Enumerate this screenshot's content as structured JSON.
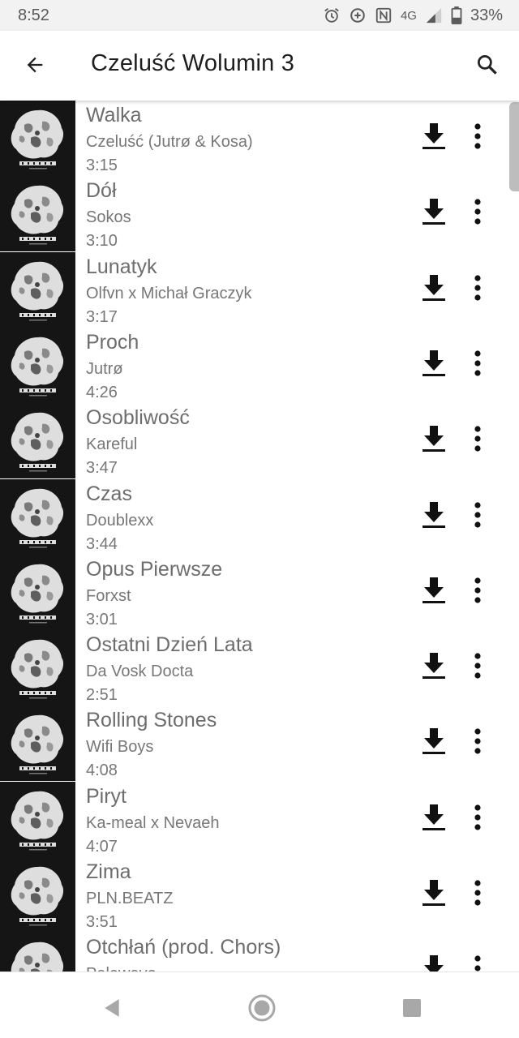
{
  "status_bar": {
    "time": "8:52",
    "network": "4G",
    "battery": "33%",
    "icons": [
      "alarm-icon",
      "data-saver-icon",
      "nfc-icon",
      "signal-icon",
      "battery-icon"
    ]
  },
  "app_bar": {
    "title": "Czeluść Wolumin 3",
    "back_icon": "arrow-back-icon",
    "search_icon": "search-icon"
  },
  "cover_art": {
    "label": "CZELUŚĆ"
  },
  "tracks": [
    {
      "title": "Walka",
      "artist": "Czeluść (Jutrø & Kosa)",
      "duration": "3:15"
    },
    {
      "title": "Dół",
      "artist": "Sokos",
      "duration": "3:10"
    },
    {
      "title": "Lunatyk",
      "artist": "Olfvn x Michał Graczyk",
      "duration": "3:17"
    },
    {
      "title": "Proch",
      "artist": "Jutrø",
      "duration": "4:26"
    },
    {
      "title": "Osobliwość",
      "artist": "Kareful",
      "duration": "3:47"
    },
    {
      "title": "Czas",
      "artist": "Doublexx",
      "duration": "3:44"
    },
    {
      "title": "Opus Pierwsze",
      "artist": "Forxst",
      "duration": "3:01"
    },
    {
      "title": "Ostatni Dzień Lata",
      "artist": "Da Vosk Docta",
      "duration": "2:51"
    },
    {
      "title": "Rolling Stones",
      "artist": "Wifi Boys",
      "duration": "4:08"
    },
    {
      "title": "Piryt",
      "artist": "Ka-meal x Nevaeh",
      "duration": "4:07"
    },
    {
      "title": "Zima",
      "artist": "PLN.BEATZ",
      "duration": "3:51"
    },
    {
      "title": "Otchłań (prod. Chors)",
      "artist": "Palewave",
      "duration": ""
    }
  ],
  "row_icons": {
    "download": "download-icon",
    "more": "more-vert-icon"
  },
  "nav_bar": {
    "back": "nav-back-icon",
    "home": "nav-home-icon",
    "recents": "nav-recents-icon"
  },
  "colors": {
    "status_bar_bg": "#f2f2f2",
    "title_text": "#1e1e1e",
    "track_text": "#6d6d6d",
    "cover_bg": "#151515"
  }
}
